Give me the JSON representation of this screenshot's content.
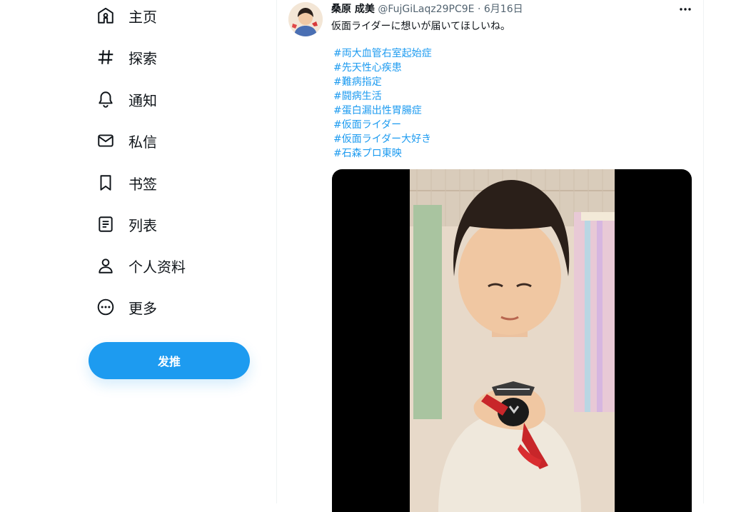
{
  "sidebar": {
    "items": [
      {
        "label": "主页",
        "icon": "home-icon"
      },
      {
        "label": "探索",
        "icon": "hashtag-icon"
      },
      {
        "label": "通知",
        "icon": "bell-icon"
      },
      {
        "label": "私信",
        "icon": "mail-icon"
      },
      {
        "label": "书签",
        "icon": "bookmark-icon"
      },
      {
        "label": "列表",
        "icon": "list-icon"
      },
      {
        "label": "个人资料",
        "icon": "profile-icon"
      },
      {
        "label": "更多",
        "icon": "more-circle-icon"
      }
    ],
    "tweet_button": "发推"
  },
  "tweet": {
    "author_name": "桑原 成美",
    "author_handle": "@FujGiLaqz29PC9E",
    "separator": "·",
    "date": "6月16日",
    "text": "仮面ライダーに想いが届いてほしいね。",
    "hashtags": [
      "#両大血管右室起始症",
      "#先天性心疾患",
      "#難病指定",
      "#闘病生活",
      "#蛋白漏出性胃腸症",
      "#仮面ライダー",
      "#仮面ライダー大好き",
      "#石森プロ東映"
    ]
  },
  "colors": {
    "accent": "#1d9bf0",
    "text": "#0f1419",
    "secondary_text": "#536471",
    "divider": "#eff3f4"
  }
}
